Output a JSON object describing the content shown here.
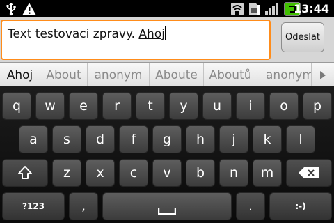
{
  "status_bar": {
    "time": "13:44",
    "icons": [
      "usb-icon",
      "warning-icon",
      "signal-a-icon",
      "sim-card-icon",
      "signal-bars-icon",
      "battery-charging-icon"
    ],
    "battery_color": "#41c000"
  },
  "compose": {
    "text_before": "Text testovaci zpravy. ",
    "current_word": "Ahoj",
    "send_label": "Odeslat",
    "accent_color": "#ff8c1a"
  },
  "suggestions": {
    "items": [
      "Ahoj",
      "About",
      "anonym",
      "Aboute",
      "Aboutů",
      "anonym"
    ],
    "more_icon": "chevron-right-icon"
  },
  "keyboard": {
    "row1": [
      "q",
      "w",
      "e",
      "r",
      "t",
      "y",
      "u",
      "i",
      "o",
      "p"
    ],
    "row2": [
      "a",
      "s",
      "d",
      "f",
      "g",
      "h",
      "j",
      "k",
      "l"
    ],
    "row3": [
      "z",
      "x",
      "c",
      "v",
      "b",
      "n",
      "m"
    ],
    "shift_icon": "shift-icon",
    "backspace_icon": "backspace-icon",
    "symbols_label": "?123",
    "comma_label": ",",
    "space_icon": "space-bar-icon",
    "period_label": ".",
    "smiley_label": ":-)"
  }
}
